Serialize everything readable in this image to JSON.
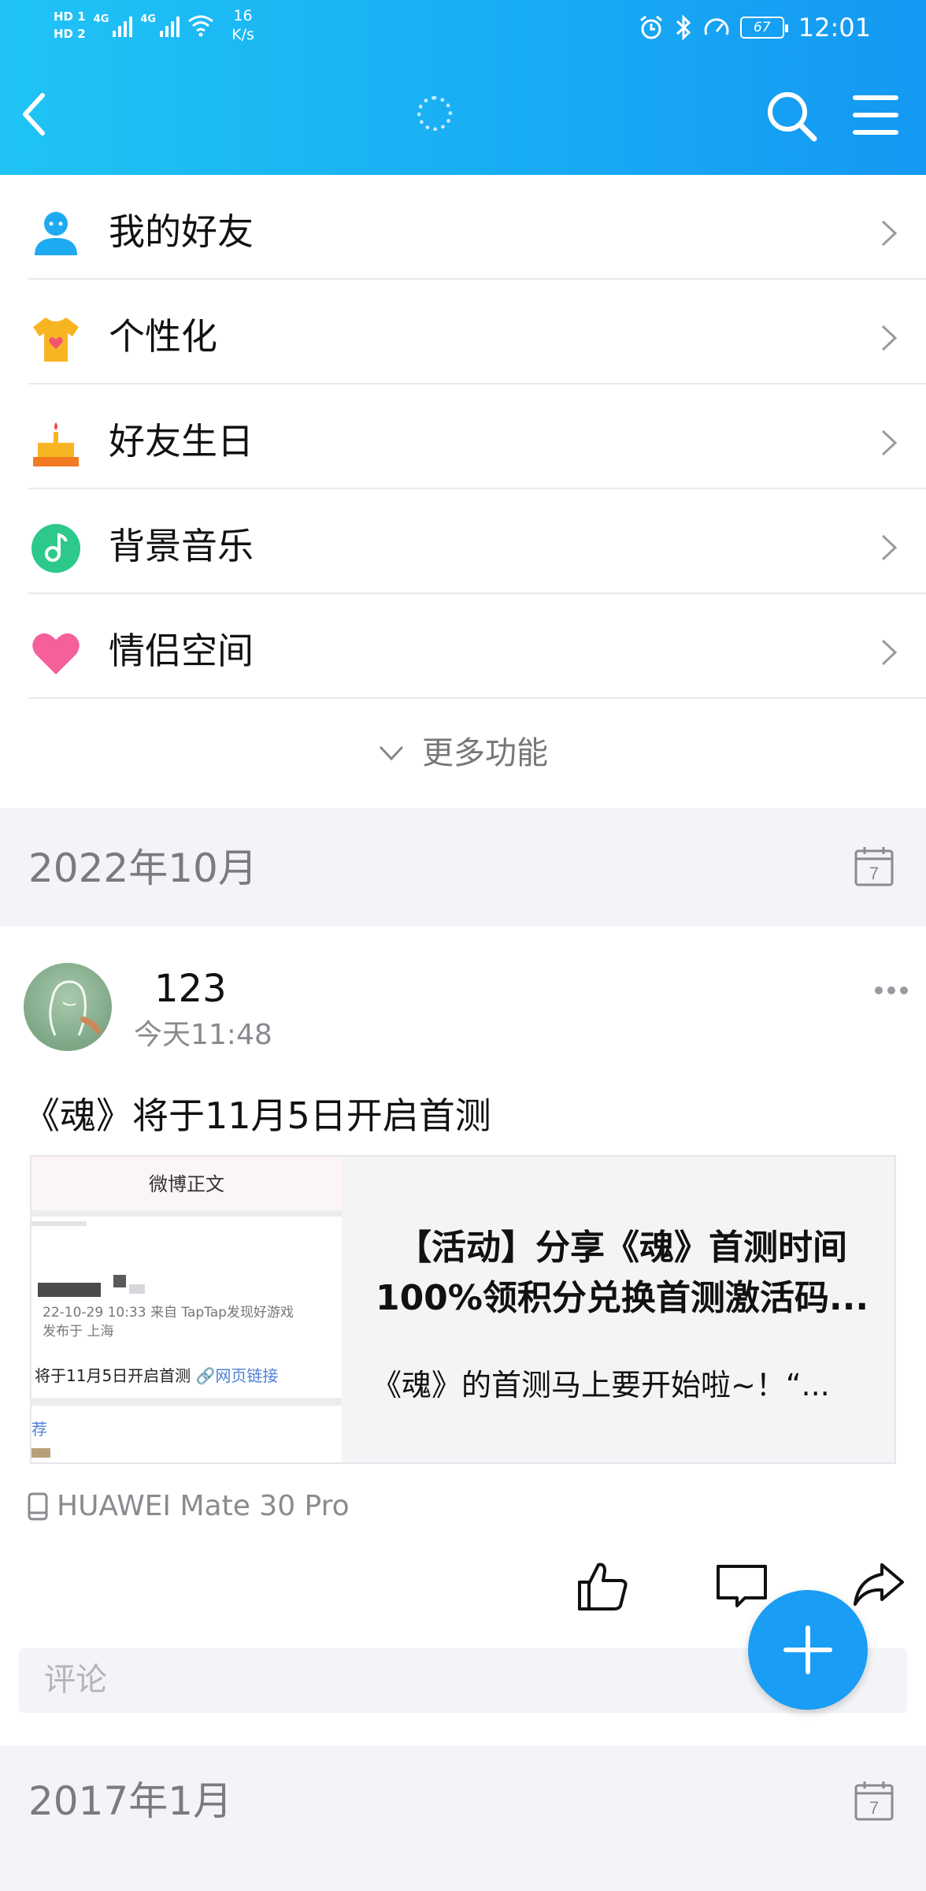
{
  "status_bar": {
    "hd1": "HD 1",
    "hd2": "HD 2",
    "net1": "4G",
    "net2": "4G",
    "speed_value": "16",
    "speed_unit": "K/s",
    "battery": "67",
    "time": "12:01"
  },
  "menu": [
    {
      "label": "我的好友",
      "icon": "friends-icon"
    },
    {
      "label": "个性化",
      "icon": "tshirt-icon"
    },
    {
      "label": "好友生日",
      "icon": "cake-icon"
    },
    {
      "label": "背景音乐",
      "icon": "music-icon"
    },
    {
      "label": "情侣空间",
      "icon": "heart-icon"
    }
  ],
  "more_label": "更多功能",
  "sections": [
    {
      "date": "2022年10月"
    },
    {
      "date": "2017年1月"
    }
  ],
  "calendar_day": "7",
  "post": {
    "username": "123",
    "time": "今天11:48",
    "text": "《魂》将于11月5日开启首测",
    "card": {
      "thumb_header": "微博正文",
      "thumb_meta_line1": "22-10-29 10:33  来自 TapTap发现好游戏",
      "thumb_meta_line2": "发布于 上海",
      "thumb_link_prefix": "将于11月5日开启首测 ",
      "thumb_link_text": "🔗网页链接",
      "thumb_rec": "荐",
      "title": "【活动】分享《魂》首测时间100%领积分兑换首测激活码...",
      "desc": "《魂》的首测马上要开始啦~！“..."
    },
    "device": "HUAWEI Mate 30 Pro",
    "comment_placeholder": "评论"
  },
  "colors": {
    "header_start": "#1fc4f5",
    "header_end": "#1499f2",
    "fab": "#1a9df4",
    "section_bg": "#f3f4f7"
  }
}
